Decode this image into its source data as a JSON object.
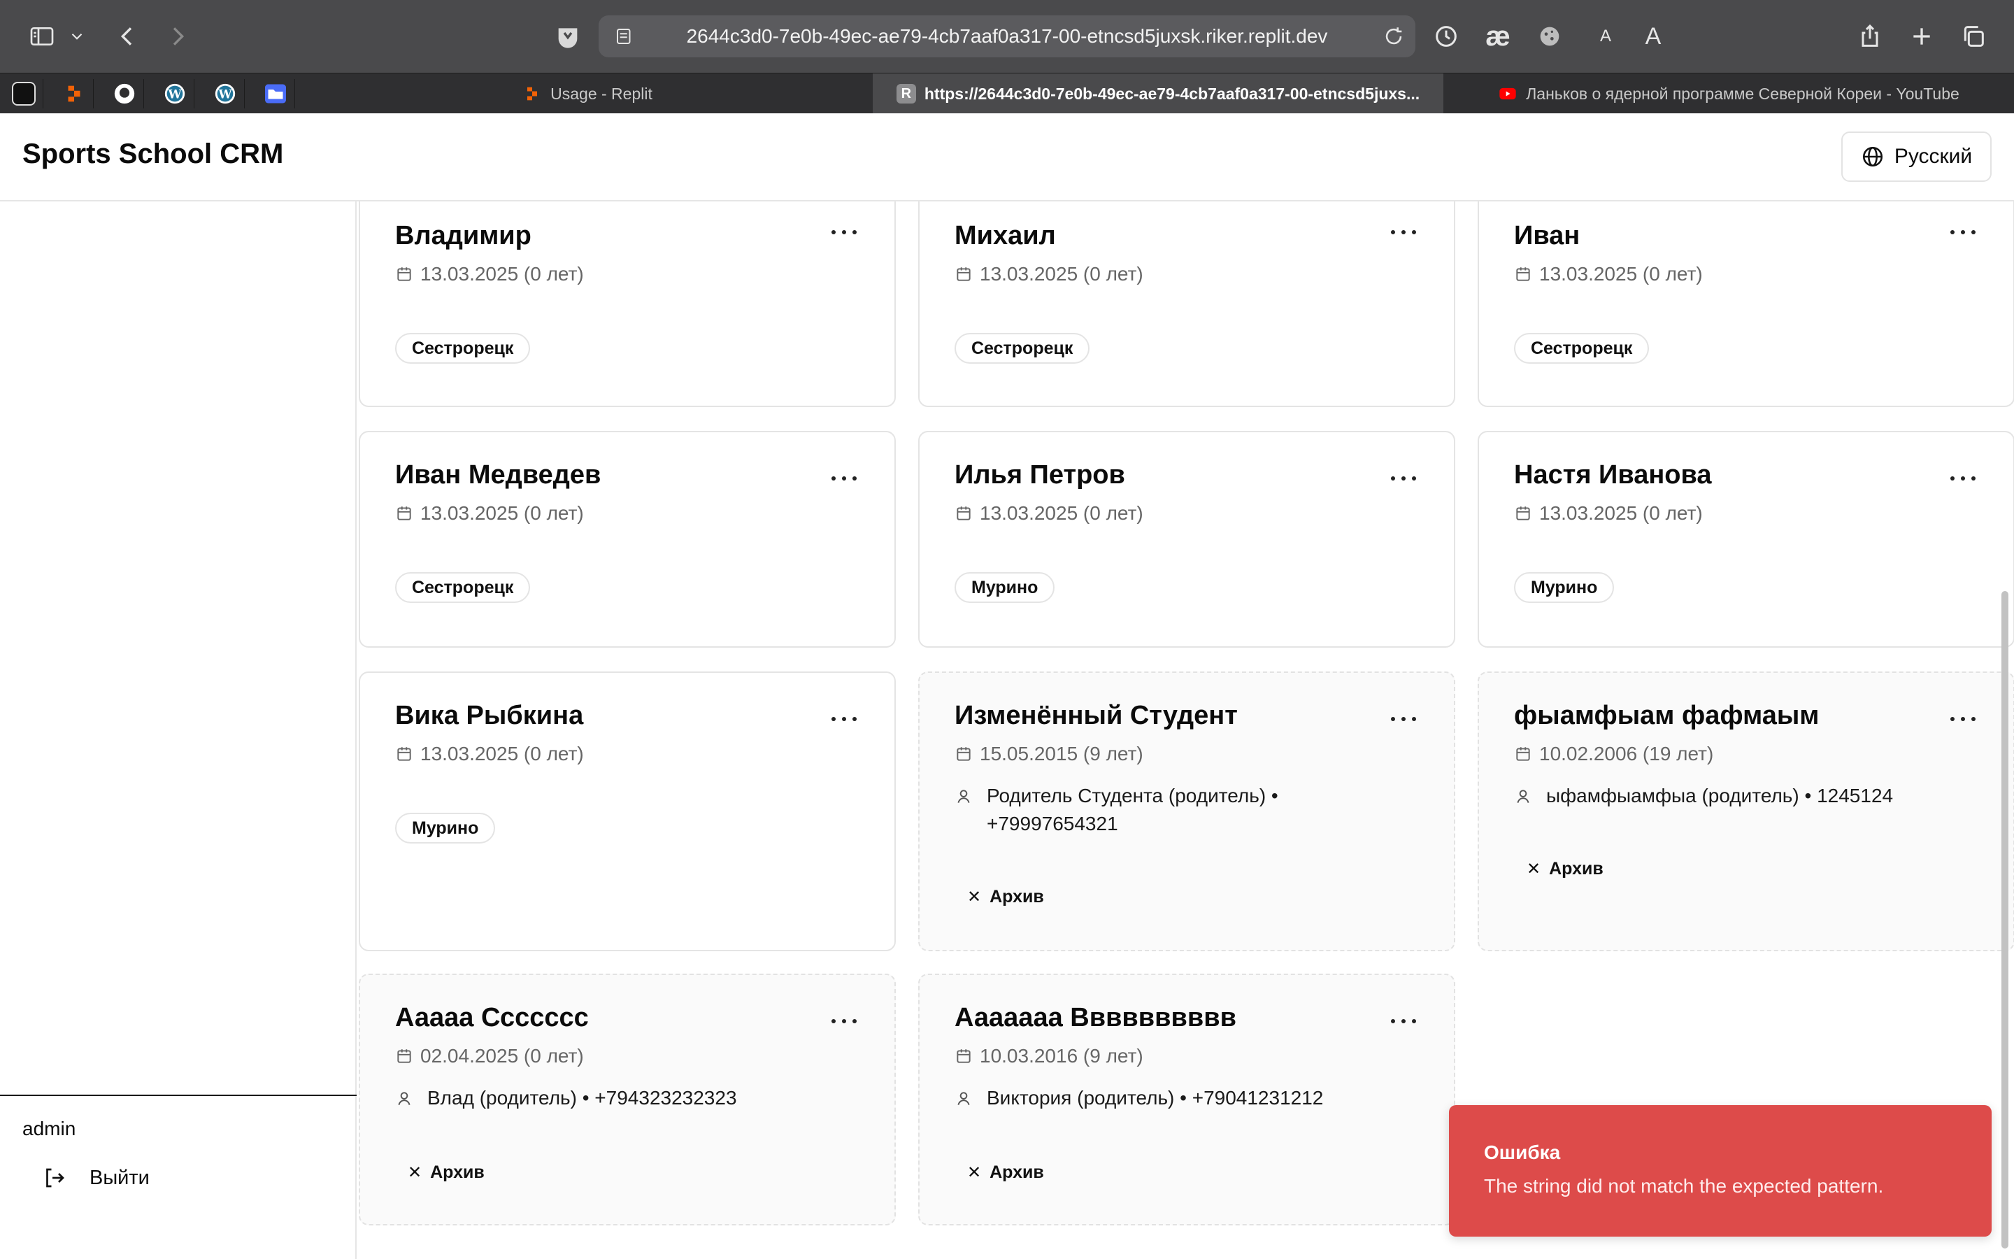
{
  "browser": {
    "url": "2644c3d0-7e0b-49ec-ae79-4cb7aaf0a317-00-etncsd5juxsk.riker.replit.dev",
    "font_small_label": "A",
    "font_large_label": "A",
    "tabs": [
      {
        "title": "Usage - Replit"
      },
      {
        "title": "https://2644c3d0-7e0b-49ec-ae79-4cb7aaf0a317-00-etncsd5juxs..."
      },
      {
        "title": "Ланьков о ядерной программе Северной Кореи - YouTube"
      }
    ]
  },
  "app": {
    "title": "Sports School CRM",
    "language_label": "Русский"
  },
  "sidebar": {
    "user": "admin",
    "logout_label": "Выйти"
  },
  "students": [
    {
      "name": "Владимир",
      "date": "13.03.2025 (0 лет)",
      "badge": "Сестрорецк"
    },
    {
      "name": "Михаил",
      "date": "13.03.2025 (0 лет)",
      "badge": "Сестрорецк"
    },
    {
      "name": "Иван",
      "date": "13.03.2025 (0 лет)",
      "badge": "Сестрорецк"
    },
    {
      "name": "Иван Медведев",
      "date": "13.03.2025 (0 лет)",
      "badge": "Сестрорецк"
    },
    {
      "name": "Илья Петров",
      "date": "13.03.2025 (0 лет)",
      "badge": "Мурино"
    },
    {
      "name": "Настя Иванова",
      "date": "13.03.2025 (0 лет)",
      "badge": "Мурино"
    },
    {
      "name": "Вика Рыбкина",
      "date": "13.03.2025 (0 лет)",
      "badge": "Мурино"
    },
    {
      "name": "Изменённый Студент",
      "date": "15.05.2015 (9 лет)",
      "parent": "Родитель Студента (родитель) • +79997654321",
      "archive": "Архив"
    },
    {
      "name": "фыамфыам фафмаым",
      "date": "10.02.2006 (19 лет)",
      "parent": "ыфамфыамфыа (родитель) • 1245124",
      "archive": "Архив"
    },
    {
      "name": "Ааааа Ссссссс",
      "date": "02.04.2025 (0 лет)",
      "parent": "Влад (родитель) • +794323232323",
      "archive": "Архив"
    },
    {
      "name": "Ааааааа Вввввввввв",
      "date": "10.03.2016 (9 лет)",
      "parent": "Виктория (родитель) • +79041231212",
      "archive": "Архив"
    }
  ],
  "toast": {
    "title": "Ошибка",
    "message": "The string did not match the expected pattern."
  }
}
